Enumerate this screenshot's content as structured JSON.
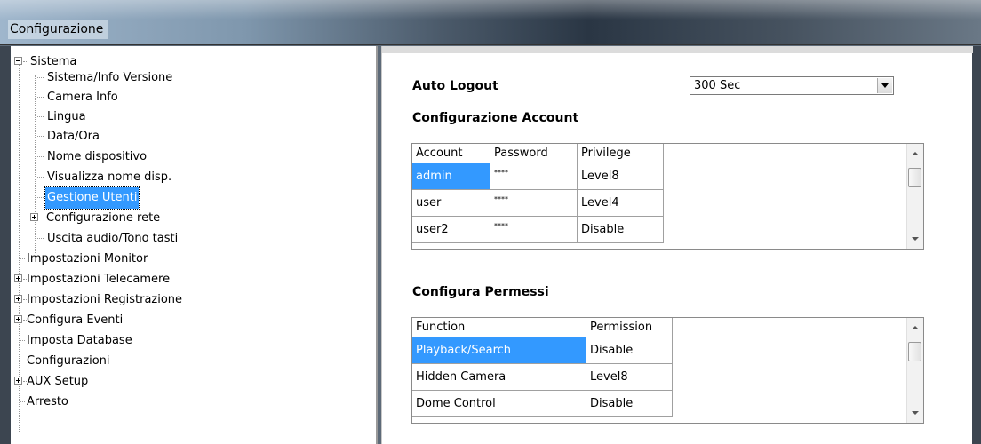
{
  "window": {
    "title": "Configurazione"
  },
  "tree": {
    "items": [
      {
        "label": "Sistema",
        "expander": "minus"
      },
      {
        "label": "Sistema/Info Versione"
      },
      {
        "label": "Camera Info"
      },
      {
        "label": "Lingua"
      },
      {
        "label": "Data/Ora"
      },
      {
        "label": "Nome dispositivo"
      },
      {
        "label": "Visualizza nome disp."
      },
      {
        "label": "Gestione Utenti",
        "selected": true
      },
      {
        "label": "Configurazione rete",
        "expander": "plus"
      },
      {
        "label": "Uscita audio/Tono tasti"
      },
      {
        "label": "Impostazioni Monitor"
      },
      {
        "label": "Impostazioni Telecamere",
        "expander": "plus"
      },
      {
        "label": "Impostazioni Registrazione",
        "expander": "plus"
      },
      {
        "label": "Configura Eventi",
        "expander": "plus"
      },
      {
        "label": "Imposta Database"
      },
      {
        "label": "Configurazioni"
      },
      {
        "label": "AUX Setup",
        "expander": "plus"
      },
      {
        "label": "Arresto"
      }
    ]
  },
  "content": {
    "auto_logout_label": "Auto Logout",
    "auto_logout_value": "300 Sec",
    "account_section_title": "Configurazione Account",
    "account_table": {
      "headers": [
        "Account",
        "Password",
        "Privilege"
      ],
      "rows": [
        {
          "account": "admin",
          "password": "****",
          "privilege": "Level8",
          "selected": true
        },
        {
          "account": "user",
          "password": "****",
          "privilege": "Level4"
        },
        {
          "account": "user2",
          "password": "****",
          "privilege": "Disable"
        }
      ]
    },
    "permission_section_title": "Configura Permessi",
    "permission_table": {
      "headers": [
        "Function",
        "Permission"
      ],
      "rows": [
        {
          "function": "Playback/Search",
          "permission": "Disable",
          "selected": true
        },
        {
          "function": "Hidden Camera",
          "permission": "Level8"
        },
        {
          "function": "Dome Control",
          "permission": "Disable"
        }
      ]
    }
  },
  "colors": {
    "selection": "#3399ff"
  },
  "icons": [
    "tree-expander-minus-icon",
    "tree-expander-plus-icon",
    "dropdown-arrow-icon",
    "scroll-up-icon",
    "scroll-down-icon"
  ]
}
